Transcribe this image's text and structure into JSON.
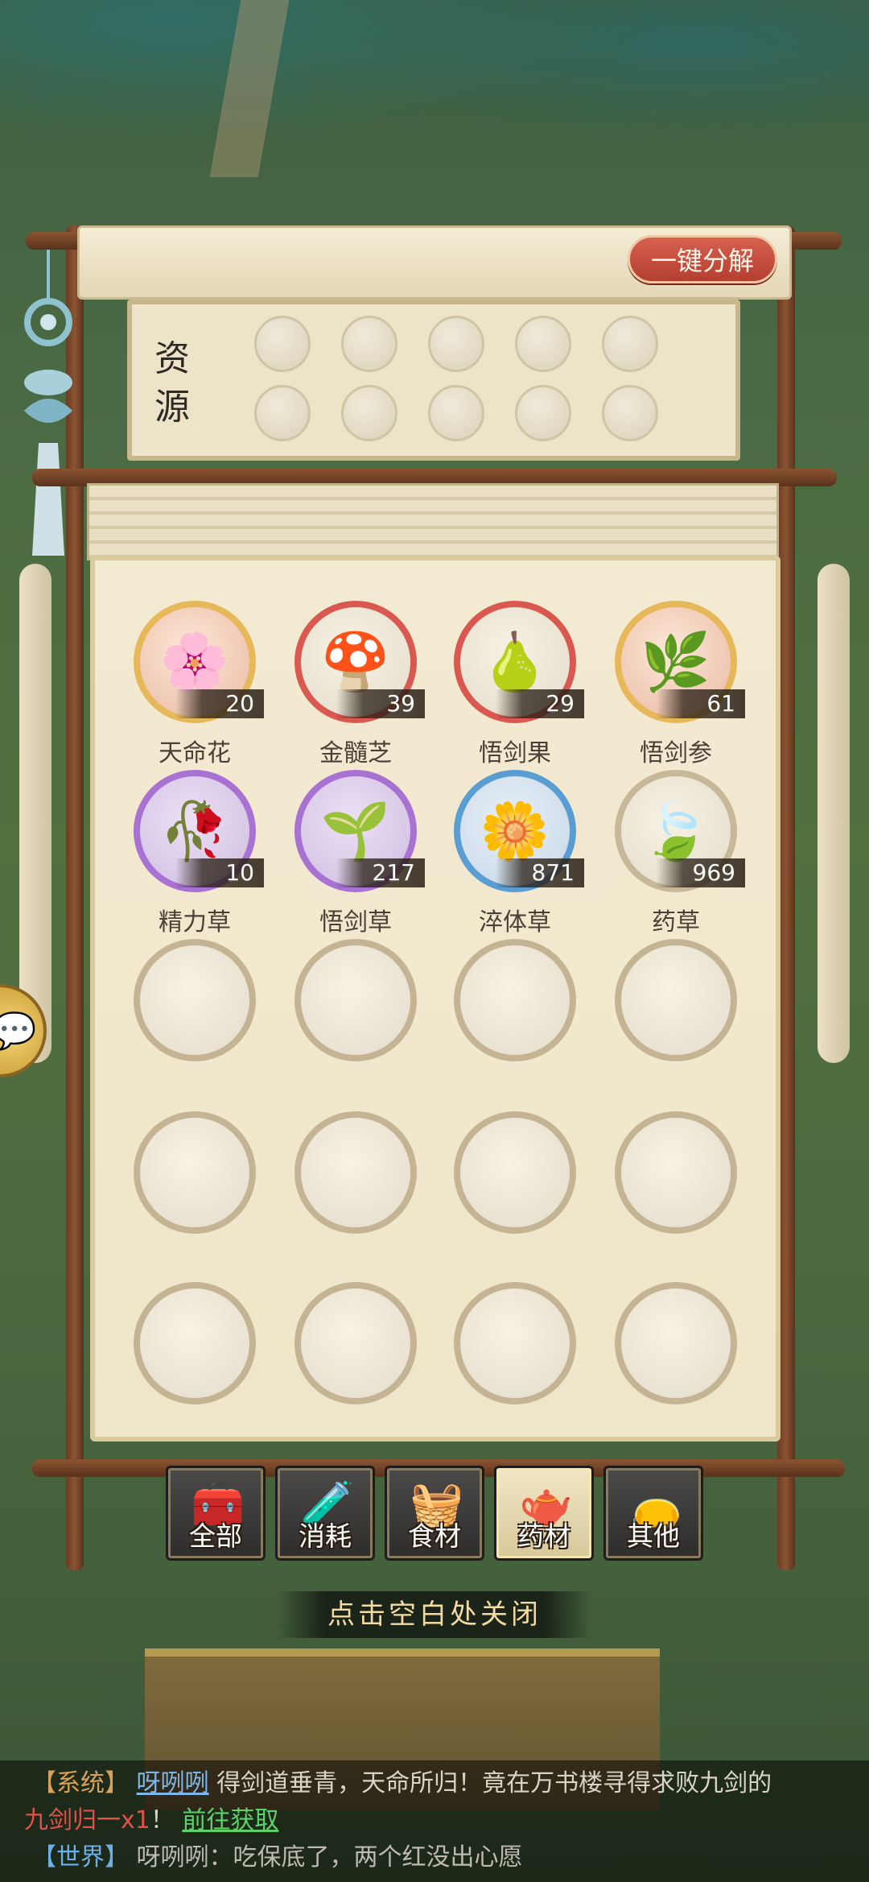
{
  "resources": {
    "title": "资源",
    "decompose_button": "一键分解"
  },
  "items": [
    {
      "name": "天命花",
      "count": "20",
      "icon": "flower-icon",
      "rarity": "gold"
    },
    {
      "name": "金髓芝",
      "count": "39",
      "icon": "mushroom-icon",
      "rarity": "red"
    },
    {
      "name": "悟剑果",
      "count": "29",
      "icon": "fruit-icon",
      "rarity": "red"
    },
    {
      "name": "悟剑参",
      "count": "61",
      "icon": "ginseng-icon",
      "rarity": "gold"
    },
    {
      "name": "精力草",
      "count": "10",
      "icon": "purple-herb-icon",
      "rarity": "purple"
    },
    {
      "name": "悟剑草",
      "count": "217",
      "icon": "grass-icon",
      "rarity": "purple"
    },
    {
      "name": "淬体草",
      "count": "871",
      "icon": "white-flower-icon",
      "rarity": "blue"
    },
    {
      "name": "药草",
      "count": "969",
      "icon": "leaf-icon",
      "rarity": "normal"
    }
  ],
  "tabs": [
    {
      "label": "全部",
      "icon": "treasure-chest-icon",
      "active": false
    },
    {
      "label": "消耗",
      "icon": "potion-icon",
      "active": false
    },
    {
      "label": "食材",
      "icon": "food-basket-icon",
      "active": false
    },
    {
      "label": "药材",
      "icon": "medicine-pot-icon",
      "active": true
    },
    {
      "label": "其他",
      "icon": "pouch-icon",
      "active": false
    }
  ],
  "close_hint": "点击空白处关闭",
  "chat": {
    "line1": {
      "channel": "【系统】",
      "user": "呀咧咧",
      "message": "得剑道垂青，天命所归！竟在万书楼寻得求败九剑的"
    },
    "line2": {
      "item": "九剑归一x1",
      "punct": "！",
      "link": "前往获取"
    },
    "line3": {
      "channel": "【世界】",
      "message": "呀咧咧：吃保底了，两个红没出心愿"
    }
  },
  "colors": {
    "accent_red": "#b33f31",
    "scroll_paper": "#f3ead2",
    "wood": "#6a3d22"
  }
}
